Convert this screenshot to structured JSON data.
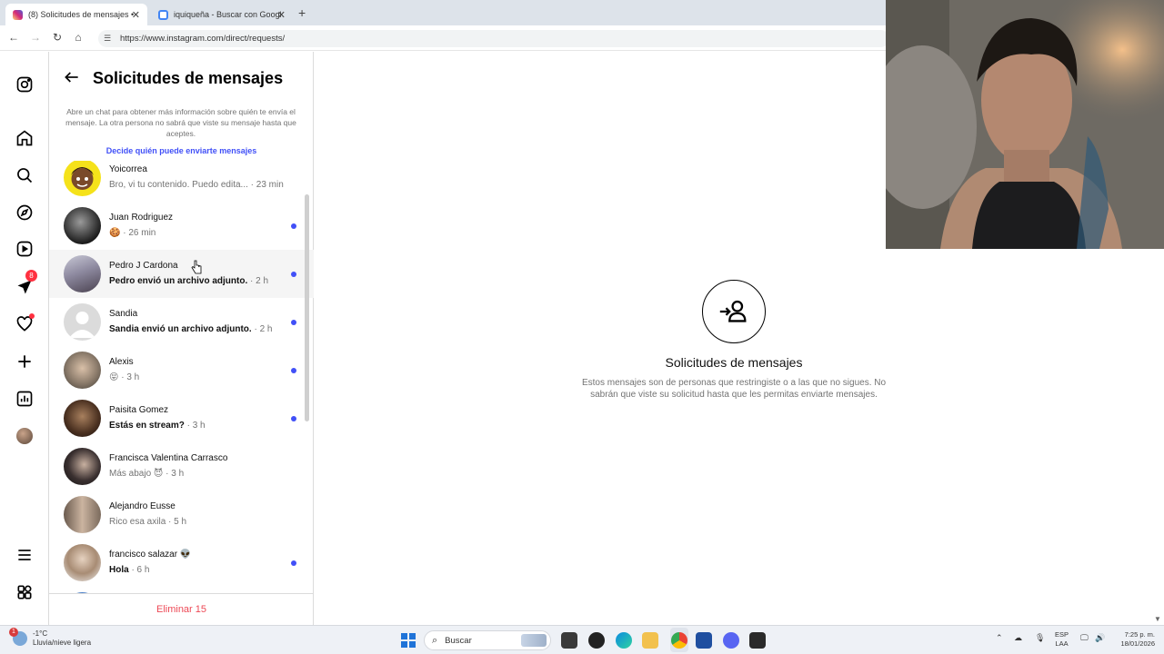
{
  "browser": {
    "tabs": [
      {
        "title": "(8) Solicitudes de mensajes • M",
        "active": true,
        "favicon_color": "#d6249f"
      },
      {
        "title": "iquiqueña - Buscar con Google",
        "active": false,
        "favicon_color": "#4285f4"
      }
    ],
    "close_glyph": "✕",
    "new_tab_glyph": "+",
    "url": "https://www.instagram.com/direct/requests/"
  },
  "nav_rail": {
    "items": [
      {
        "name": "instagram-logo-icon"
      },
      {
        "name": "home-icon"
      },
      {
        "name": "search-icon"
      },
      {
        "name": "explore-icon"
      },
      {
        "name": "reels-icon"
      },
      {
        "name": "messages-icon",
        "badge": "8"
      },
      {
        "name": "notifications-icon"
      },
      {
        "name": "create-icon"
      },
      {
        "name": "dashboard-icon"
      },
      {
        "name": "profile-avatar"
      },
      {
        "name": "more-menu-icon"
      },
      {
        "name": "also-from-meta-icon"
      }
    ]
  },
  "requests_panel": {
    "title": "Solicitudes de mensajes",
    "description": "Abre un chat para obtener más información sobre quién te envía el mensaje. La otra persona no sabrá que viste su mensaje hasta que aceptes.",
    "decide_link": "Decide quién puede enviarte mensajes",
    "rows": [
      {
        "name": "Yoicorrea",
        "preview": "Bro, vi tu contenido. Puedo edita...",
        "time": " · 23 min",
        "unread": false
      },
      {
        "name": "Juan Rodriguez",
        "preview": "🍪",
        "time": " · 26 min",
        "unread": true
      },
      {
        "name": "Pedro J Cardona",
        "preview": "Pedro envió un archivo adjunto.",
        "time": " · 2 h",
        "unread": true
      },
      {
        "name": "Sandia",
        "preview": "Sandia envió un archivo adjunto.",
        "time": " · 2 h",
        "unread": true
      },
      {
        "name": "Alexis",
        "preview": "😝",
        "time": " · 3 h",
        "unread": true
      },
      {
        "name": "Paisita Gomez",
        "preview": "Estás en stream?",
        "time": " · 3 h",
        "unread": true
      },
      {
        "name": "Francisca Valentina Carrasco",
        "preview": "Más abajo 😈",
        "time": " · 3 h",
        "unread": false
      },
      {
        "name": "Alejandro Eusse",
        "preview": "Rico esa axila",
        "time": " · 5 h",
        "unread": false
      },
      {
        "name": "francisco salazar 👽",
        "preview": "Hola",
        "time": " · 6 h",
        "unread": true
      }
    ],
    "delete_label": "Eliminar 15"
  },
  "main": {
    "title": "Solicitudes de mensajes",
    "description": "Estos mensajes son de personas que restringiste o a las que no sigues. No sabrán que viste su solicitud hasta que les permitas enviarte mensajes."
  },
  "taskbar": {
    "weather_temp": "-1°C",
    "weather_desc": "Lluvia/nieve ligera",
    "weather_badge": "1",
    "search_placeholder": "Buscar",
    "lang_line1": "ESP",
    "lang_line2": "LAA",
    "time": "7:25 p. m.",
    "date": "18/01/2026"
  },
  "colors": {
    "accent_blue": "#4150f7",
    "delete_red": "#ed4956",
    "badge_red": "#ff3040"
  }
}
